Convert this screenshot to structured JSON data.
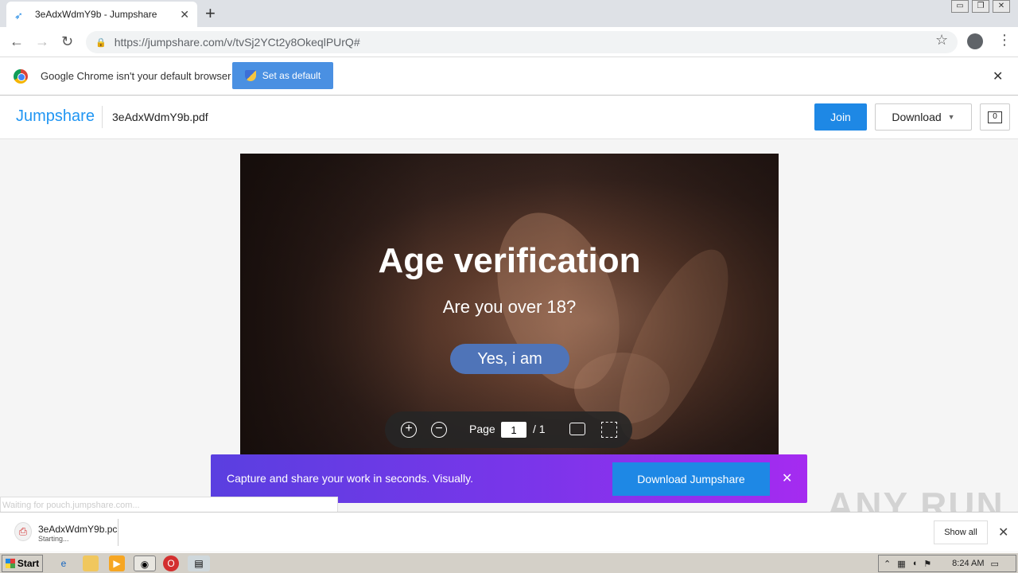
{
  "browser": {
    "tab_title": "3eAdxWdmY9b - Jumpshare",
    "tab_close": "✕",
    "new_tab": "+",
    "url": "https://jumpshare.com/v/tvSj2YCt2y8OkeqlPUrQ#",
    "window_controls": [
      "▭",
      "❐",
      "✕"
    ]
  },
  "infobar": {
    "message": "Google Chrome isn't your default browser",
    "set_default_label": "Set as default",
    "close": "✕"
  },
  "jumpshare": {
    "logo": "Jumpshare",
    "filename": "3eAdxWdmY9b.pdf",
    "join_label": "Join",
    "download_label": "Download",
    "comments_count": "0"
  },
  "document": {
    "title": "Age verification",
    "subtitle": "Are you over 18?",
    "button": "Yes, i am"
  },
  "pdf_controls": {
    "zoom_in": "+",
    "zoom_out": "−",
    "page_label": "Page",
    "page_value": "1",
    "page_total": "/ 1"
  },
  "promo": {
    "text": "Capture and share your work in seconds. Visually.",
    "button": "Download Jumpshare",
    "close": "✕"
  },
  "status_text": "Waiting for pouch.jumpshare.com...",
  "downloads": {
    "file": "3eAdxWdmY9b.pc",
    "status": "Starting...",
    "show_all": "Show all",
    "close": "✕"
  },
  "watermark": "ANY RUN",
  "taskbar": {
    "start": "Start",
    "time": "8:24 AM"
  }
}
